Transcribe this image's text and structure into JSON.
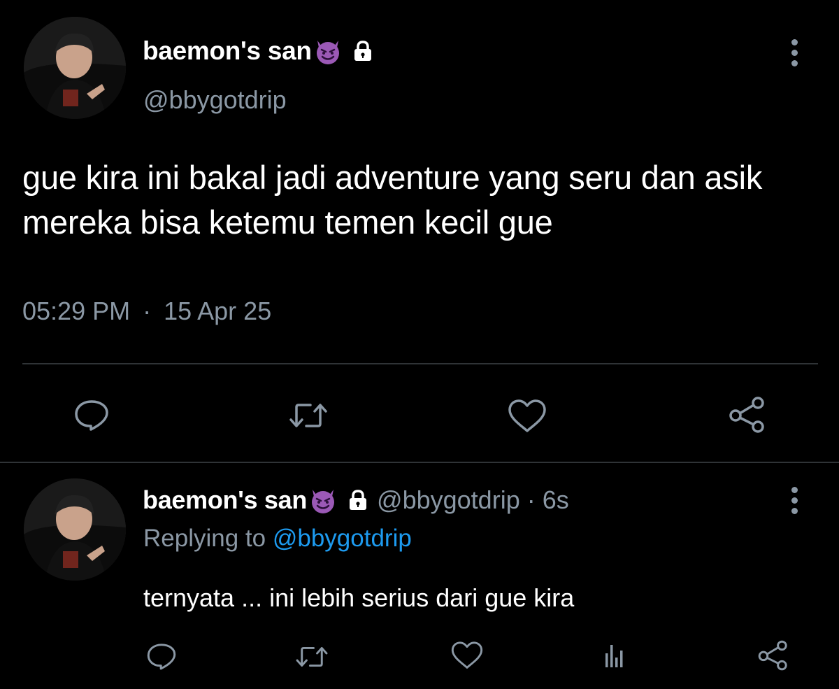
{
  "main_tweet": {
    "display_name": "baemon's san",
    "handle": "@bbygotdrip",
    "text": "gue kira ini bakal jadi adventure yang seru dan asik mereka bisa ketemu temen kecil gue",
    "time": "05:29 PM",
    "separator": "·",
    "date": "15 Apr 25",
    "actions": [
      "reply-icon",
      "retweet-icon",
      "like-icon",
      "share-icon"
    ]
  },
  "reply_tweet": {
    "display_name": "baemon's san",
    "handle_time": "@bbygotdrip · 6s",
    "replying_prefix": "Replying to ",
    "replying_mention": "@bbygotdrip",
    "text": "ternyata ... ini lebih serius dari gue kira",
    "actions": [
      "reply-icon",
      "retweet-icon",
      "like-icon",
      "analytics-icon",
      "share-icon"
    ]
  },
  "colors": {
    "background": "#000000",
    "text_primary": "#ffffff",
    "text_secondary": "#8b98a5",
    "link": "#1d9bf0",
    "divider": "#2f3336",
    "devil_emoji": "#9b59b6"
  },
  "icons": {
    "name_emoji": "smiling-face-with-horns-icon",
    "protected": "lock-icon",
    "overflow": "more-vertical-icon"
  }
}
